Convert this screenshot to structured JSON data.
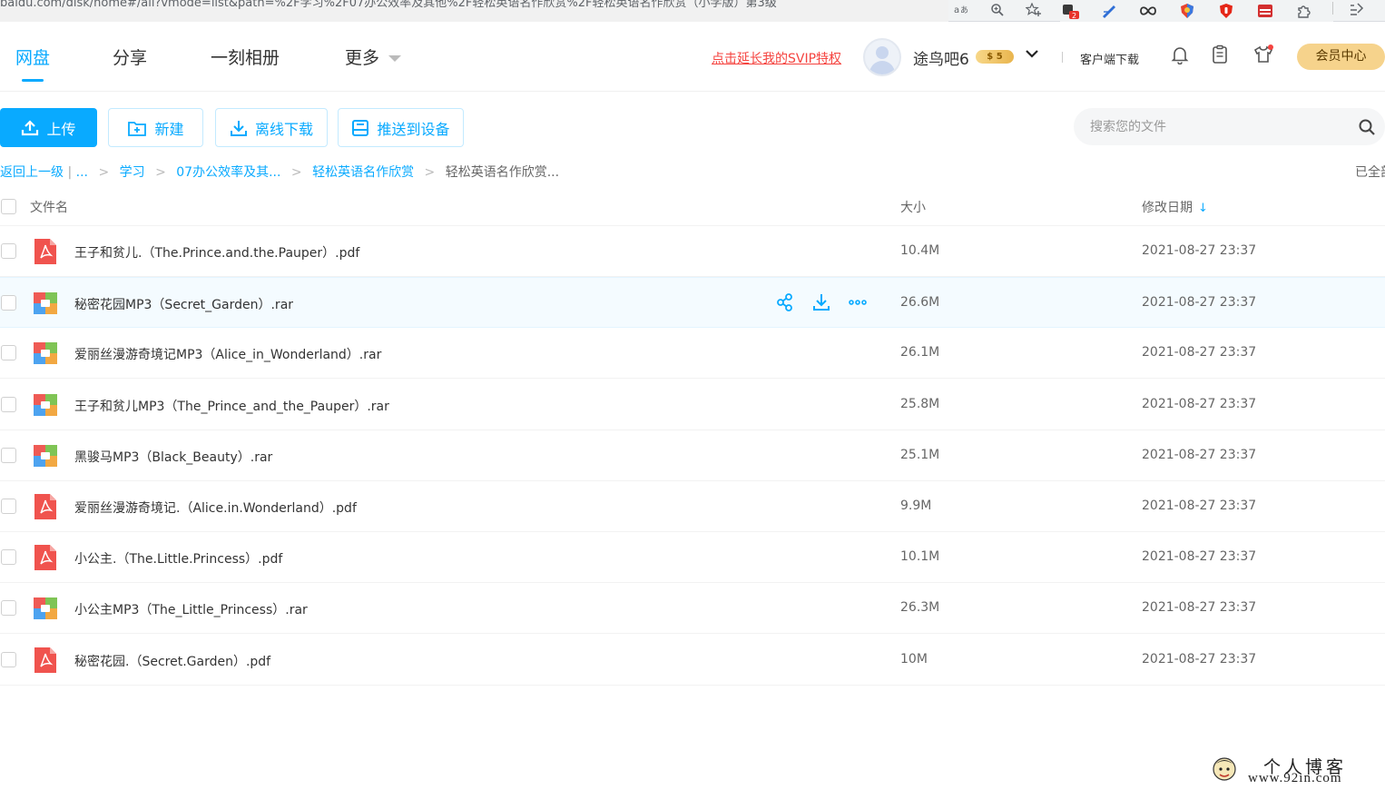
{
  "browser": {
    "url": "baidu.com/disk/home#/all?vmode=list&path=%2F学习%2F07办公效率及其他%2F轻松英语名作欣赏%2F轻松英语名作欣赏（小学版）第3级",
    "ext_badge": "2"
  },
  "nav": {
    "tabs": [
      "网盘",
      "分享",
      "一刻相册",
      "更多"
    ],
    "svip_link": "点击延长我的SVIP特权",
    "username": "途鸟吧6",
    "vip_badge": "$ 5",
    "client_download": "客户端下载",
    "member_center": "会员中心"
  },
  "toolbar": {
    "upload": "上传",
    "new": "新建",
    "offline_download": "离线下载",
    "push_to_device": "推送到设备",
    "search_placeholder": "搜索您的文件"
  },
  "breadcrumb": {
    "back": "返回上一级",
    "sep": "|",
    "ellipsis": "...",
    "items": [
      "学习",
      "07办公效率及其...",
      "轻松英语名作欣赏"
    ],
    "current": "轻松英语名作欣赏...",
    "loaded_status": "已全部"
  },
  "table": {
    "col_name": "文件名",
    "col_size": "大小",
    "col_date": "修改日期",
    "sort_indicator": "↓",
    "rows": [
      {
        "name": "王子和贫儿.（The.Prince.and.the.Pauper）.pdf",
        "type": "pdf",
        "size": "10.4M",
        "date": "2021-08-27 23:37"
      },
      {
        "name": "秘密花园MP3（Secret_Garden）.rar",
        "type": "rar",
        "size": "26.6M",
        "date": "2021-08-27 23:37"
      },
      {
        "name": "爱丽丝漫游奇境记MP3（Alice_in_Wonderland）.rar",
        "type": "rar",
        "size": "26.1M",
        "date": "2021-08-27 23:37"
      },
      {
        "name": "王子和贫儿MP3（The_Prince_and_the_Pauper）.rar",
        "type": "rar",
        "size": "25.8M",
        "date": "2021-08-27 23:37"
      },
      {
        "name": "黑骏马MP3（Black_Beauty）.rar",
        "type": "rar",
        "size": "25.1M",
        "date": "2021-08-27 23:37"
      },
      {
        "name": "爱丽丝漫游奇境记.（Alice.in.Wonderland）.pdf",
        "type": "pdf",
        "size": "9.9M",
        "date": "2021-08-27 23:37"
      },
      {
        "name": "小公主.（The.Little.Princess）.pdf",
        "type": "pdf",
        "size": "10.1M",
        "date": "2021-08-27 23:37"
      },
      {
        "name": "小公主MP3（The_Little_Princess）.rar",
        "type": "rar",
        "size": "26.3M",
        "date": "2021-08-27 23:37"
      },
      {
        "name": "秘密花园.（Secret.Garden）.pdf",
        "type": "pdf",
        "size": "10M",
        "date": "2021-08-27 23:37"
      }
    ]
  },
  "watermark": {
    "line1": "个人博客",
    "line2": "www.92in.com"
  },
  "colors": {
    "accent": "#09aaff",
    "svip_link": "#f5433f",
    "member_btn": "#f6d38c",
    "pdf_red": "#f0534e"
  }
}
